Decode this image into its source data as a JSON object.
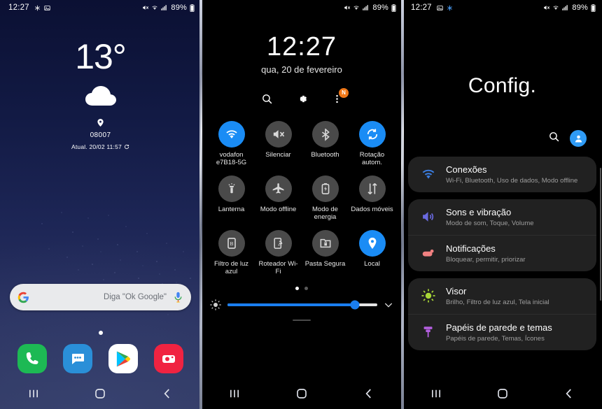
{
  "statusbar": {
    "time": "12:27",
    "battery_text": "89%",
    "left_icons": [
      "snowflake-icon",
      "image-icon"
    ],
    "right_icons": [
      "mute-icon",
      "wifi-icon",
      "signal-icon",
      "battery-icon"
    ]
  },
  "home": {
    "weather": {
      "temperature": "13°",
      "condition_icon": "cloud-icon",
      "location": "08007",
      "updated": "Atual. 20/02 11:57",
      "refresh_icon": "refresh-icon"
    },
    "search": {
      "placeholder": "Diga \"Ok Google\"",
      "logo": "google-g-icon",
      "mic": "microphone-icon"
    },
    "page_indicator": {
      "pages": 1,
      "active": 0
    },
    "dock": [
      {
        "name": "phone",
        "label": "Telefone",
        "color": "#1db954"
      },
      {
        "name": "messages",
        "label": "Mensagens",
        "color": "#2a8fd8"
      },
      {
        "name": "play-store",
        "label": "Play Store",
        "color": "#ffffff"
      },
      {
        "name": "camera",
        "label": "Câmera",
        "color": "#f02341"
      }
    ]
  },
  "quick": {
    "clock": "12:27",
    "date": "qua, 20 de fevereiro",
    "actions": [
      {
        "name": "search",
        "icon": "search-icon",
        "badge": ""
      },
      {
        "name": "settings",
        "icon": "gear-icon",
        "badge": ""
      },
      {
        "name": "more",
        "icon": "more-vertical-icon",
        "badge": "N"
      }
    ],
    "tiles": [
      {
        "label": "vodafon e7B18-5G",
        "icon": "wifi-icon",
        "active": true
      },
      {
        "label": "Silenciar",
        "icon": "mute-icon",
        "active": false
      },
      {
        "label": "Bluetooth",
        "icon": "bluetooth-icon",
        "active": false
      },
      {
        "label": "Rotação autom.",
        "icon": "rotate-icon",
        "active": true
      },
      {
        "label": "Lanterna",
        "icon": "flashlight-icon",
        "active": false
      },
      {
        "label": "Modo offline",
        "icon": "airplane-icon",
        "active": false
      },
      {
        "label": "Modo de energia",
        "icon": "battery-icon",
        "active": false
      },
      {
        "label": "Dados móveis",
        "icon": "data-arrows-icon",
        "active": false
      },
      {
        "label": "Filtro de luz azul",
        "icon": "blue-light-icon",
        "active": false
      },
      {
        "label": "Roteador Wi-Fi",
        "icon": "hotspot-icon",
        "active": false
      },
      {
        "label": "Pasta Segura",
        "icon": "secure-folder-icon",
        "active": false
      },
      {
        "label": "Local",
        "icon": "location-pin-icon",
        "active": true
      }
    ],
    "pages": {
      "count": 2,
      "active": 0
    },
    "brightness": {
      "value": 85,
      "icon": "brightness-icon",
      "expand_icon": "chevron-down-icon"
    }
  },
  "settings": {
    "title": "Config.",
    "search_icon": "search-icon",
    "avatar_icon": "account-avatar-icon",
    "groups": [
      {
        "items": [
          {
            "title": "Conexões",
            "subtitle": "Wi-Fi, Bluetooth, Uso de dados, Modo offline",
            "icon": "wifi-icon",
            "color": "#3b7de0"
          }
        ]
      },
      {
        "items": [
          {
            "title": "Sons e vibração",
            "subtitle": "Modo de som, Toque, Volume",
            "icon": "speaker-icon",
            "color": "#6a6ae0"
          },
          {
            "title": "Notificações",
            "subtitle": "Bloquear, permitir, priorizar",
            "icon": "notification-icon",
            "color": "#f08080"
          }
        ]
      },
      {
        "items": [
          {
            "title": "Visor",
            "subtitle": "Brilho, Filtro de luz azul, Tela inicial",
            "icon": "brightness-icon",
            "color": "#a8d636"
          },
          {
            "title": "Papéis de parede e temas",
            "subtitle": "Papéis de parede, Temas, Ícones",
            "icon": "paint-roller-icon",
            "color": "#b45fe0"
          }
        ]
      }
    ]
  },
  "navbar": {
    "recents": "recents-icon",
    "home": "home-icon",
    "back": "back-icon"
  },
  "colors": {
    "accent_blue": "#1a8cf5",
    "tile_off": "#4a4a4a",
    "card_bg": "#212121",
    "badge_orange": "#f07818"
  }
}
